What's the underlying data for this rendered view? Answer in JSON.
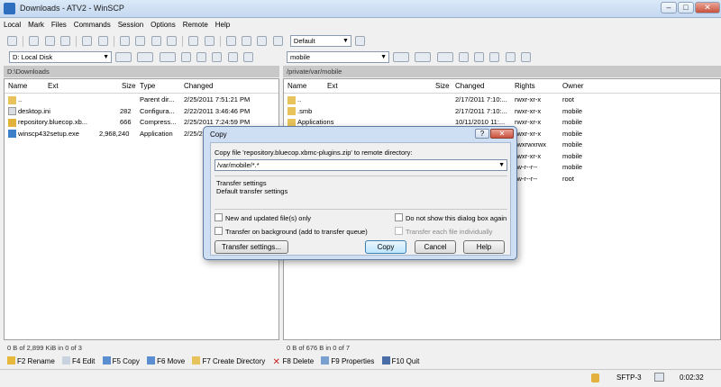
{
  "window": {
    "title": "Downloads - ATV2 - WinSCP"
  },
  "menu": [
    "Local",
    "Mark",
    "Files",
    "Commands",
    "Session",
    "Options",
    "Remote",
    "Help"
  ],
  "toolbar": {
    "transfer_settings_value": "Default"
  },
  "left": {
    "drive": "D: Local Disk",
    "path": "D:\\Downloads",
    "columns": {
      "name": "Name",
      "ext": "Ext",
      "size": "Size",
      "type": "Type",
      "changed": "Changed"
    },
    "files": [
      {
        "name": "..",
        "size": "",
        "type": "Parent dir...",
        "changed": "2/25/2011  7:51:21 PM"
      },
      {
        "name": "desktop.ini",
        "size": "282",
        "type": "Configura...",
        "changed": "2/22/2011  3:46:46 PM"
      },
      {
        "name": "repository.bluecop.xb...",
        "size": "666",
        "type": "Compress...",
        "changed": "2/25/2011  7:24:59 PM"
      },
      {
        "name": "winscp432setup.exe",
        "size": "2,968,240",
        "type": "Application",
        "changed": "2/25/2"
      }
    ],
    "status": "0 B of 2,899 KiB in 0 of 3"
  },
  "right": {
    "drive": "mobile",
    "path": "/private/var/mobile",
    "columns": {
      "name": "Name",
      "ext": "Ext",
      "size": "Size",
      "changed": "Changed",
      "rights": "Rights",
      "owner": "Owner"
    },
    "files": [
      {
        "name": "..",
        "changed": "2/17/2011  7:10:...",
        "rights": "rwxr-xr-x",
        "owner": "root"
      },
      {
        "name": ".smb",
        "changed": "2/17/2011  7:10:...",
        "rights": "rwxr-xr-x",
        "owner": "mobile"
      },
      {
        "name": "Applications",
        "changed": "10/11/2010 11:...",
        "rights": "rwxr-xr-x",
        "owner": "mobile"
      },
      {
        "name": "",
        "changed": "",
        "rights": "rwxr-xr-x",
        "owner": "mobile"
      },
      {
        "name": "",
        "changed": "",
        "rights": "rwxrwxrwx",
        "owner": "mobile"
      },
      {
        "name": "",
        "changed": "",
        "rights": "rwxr-xr-x",
        "owner": "mobile"
      },
      {
        "name": "",
        "changed": "",
        "rights": "rw-r--r--",
        "owner": "mobile"
      },
      {
        "name": "",
        "changed": "",
        "rights": "rw-r--r--",
        "owner": "root"
      }
    ],
    "status": "0 B of 676 B in 0 of 7"
  },
  "commands": [
    "F2 Rename",
    "F4 Edit",
    "F5 Copy",
    "F6 Move",
    "F7 Create Directory",
    "F8 Delete",
    "F9 Properties",
    "F10 Quit"
  ],
  "statusbar": {
    "protocol": "SFTP-3",
    "time": "0:02:32"
  },
  "dialog": {
    "title": "Copy",
    "prompt": "Copy file 'repository.bluecop.xbmc-plugins.zip' to remote directory:",
    "target": "/var/mobile/*.*",
    "settings_title": "Transfer settings",
    "settings_value": "Default transfer settings",
    "new_and_updated": "New and updated file(s) only",
    "do_not_show": "Do not show this dialog box again",
    "background": "Transfer on background (add to transfer queue)",
    "each_file": "Transfer each file individually",
    "transfer_settings_btn": "Transfer settings...",
    "copy_btn": "Copy",
    "cancel_btn": "Cancel",
    "help_btn": "Help"
  },
  "colors": {
    "titlebar": "#c4d8ef",
    "path_bar": "#c8c8c8",
    "dialog_frame": "#cfdff3",
    "folder": "#e8c25a"
  }
}
